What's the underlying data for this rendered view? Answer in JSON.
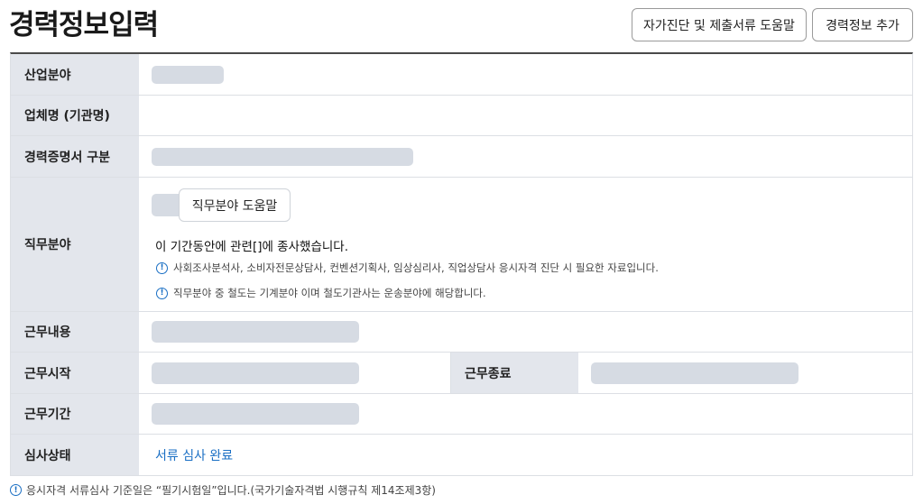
{
  "header": {
    "title": "경력정보입력",
    "help_button": "자가진단 및 제출서류 도움말",
    "add_button": "경력정보 추가"
  },
  "form": {
    "industry_label": "산업분야",
    "company_label": "업체명 (기관명)",
    "cert_type_label": "경력증명서 구분",
    "job_field_label": "직무분야",
    "job_field_help_button": "직무분야 도움말",
    "job_field_sentence": "이 기간동안에 관련[]에 종사했습니다.",
    "job_field_note_1": "사회조사분석사, 소비자전문상담사, 컨벤션기획사, 임상심리사, 직업상담사 응시자격 진단 시 필요한 자료입니다.",
    "job_field_note_2": "직무분야 중 철도는 기계분야 이며 철도기관사는 운송분야에 해당합니다.",
    "work_content_label": "근무내용",
    "start_label": "근무시작",
    "end_label": "근무종료",
    "period_label": "근무기간",
    "status_label": "심사상태",
    "status_value": "서류 심사 완료"
  },
  "footnote": "응시자격 서류심사 기준일은 “필기시험일”입니다.(국가기술자격법 시행규칙 제14조제3항)",
  "icons": {
    "info": "info-circle-icon"
  },
  "colors": {
    "accent": "#1a6fc4",
    "label_bg": "#e3e6ec",
    "placeholder": "#d6dbe3"
  }
}
